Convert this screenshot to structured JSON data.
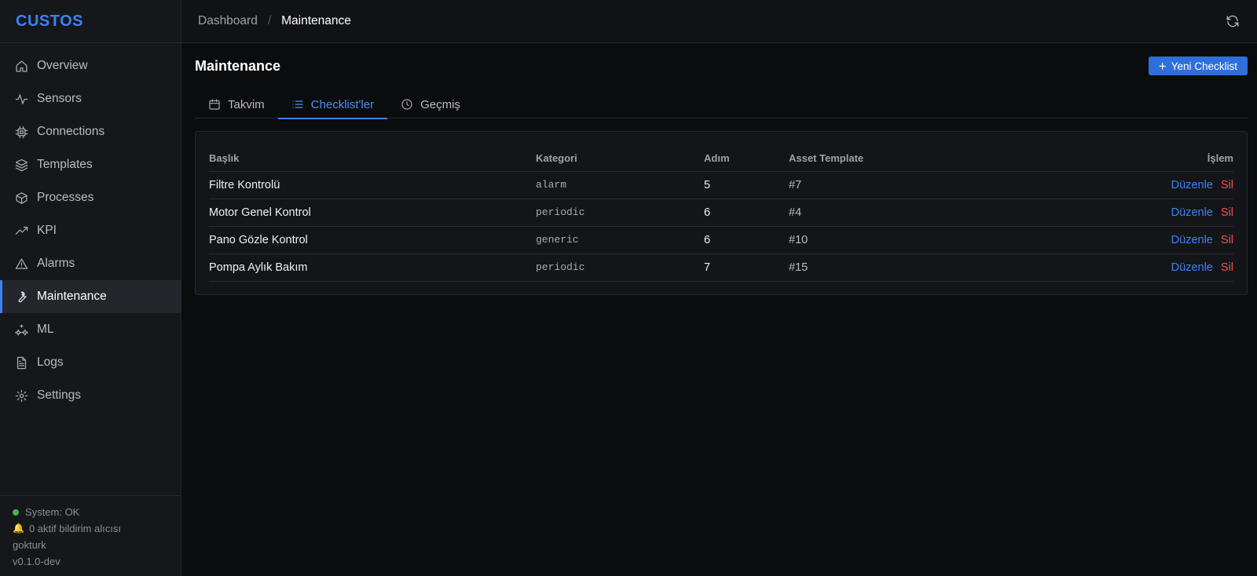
{
  "brand": "CUSTOS",
  "sidebar": {
    "items": [
      {
        "label": "Overview",
        "icon": "home-icon"
      },
      {
        "label": "Sensors",
        "icon": "activity-icon"
      },
      {
        "label": "Connections",
        "icon": "chip-icon"
      },
      {
        "label": "Templates",
        "icon": "layers-icon"
      },
      {
        "label": "Processes",
        "icon": "box-icon"
      },
      {
        "label": "KPI",
        "icon": "trending-up-icon"
      },
      {
        "label": "Alarms",
        "icon": "alert-triangle-icon"
      },
      {
        "label": "Maintenance",
        "icon": "wrench-icon",
        "active": true
      },
      {
        "label": "ML",
        "icon": "sparkles-icon"
      },
      {
        "label": "Logs",
        "icon": "file-text-icon"
      },
      {
        "label": "Settings",
        "icon": "gear-icon"
      }
    ],
    "footer": {
      "system_status": "System: OK",
      "notifications": "0 aktif bildirim alıcısı",
      "user": "gokturk",
      "version": "v0.1.0-dev"
    }
  },
  "breadcrumb": {
    "parent": "Dashboard",
    "separator": "/",
    "current": "Maintenance"
  },
  "page": {
    "title": "Maintenance",
    "new_button": "Yeni Checklist"
  },
  "tabs": [
    {
      "label": "Takvim",
      "icon": "calendar-icon"
    },
    {
      "label": "Checklist'ler",
      "icon": "list-icon",
      "active": true
    },
    {
      "label": "Geçmiş",
      "icon": "clock-icon"
    }
  ],
  "table": {
    "headers": {
      "title": "Başlık",
      "category": "Kategori",
      "steps": "Adım",
      "asset": "Asset Template",
      "actions": "İşlem"
    },
    "rows": [
      {
        "title": "Filtre Kontrolü",
        "category": "alarm",
        "steps": "5",
        "asset": "#7"
      },
      {
        "title": "Motor Genel Kontrol",
        "category": "periodic",
        "steps": "6",
        "asset": "#4"
      },
      {
        "title": "Pano Gözle Kontrol",
        "category": "generic",
        "steps": "6",
        "asset": "#10"
      },
      {
        "title": "Pompa Aylık Bakım",
        "category": "periodic",
        "steps": "7",
        "asset": "#15"
      }
    ],
    "edit_label": "Düzenle",
    "delete_label": "Sil"
  },
  "colors": {
    "accent": "#3b82f6",
    "danger": "#ef5350",
    "status_ok": "#4caf50"
  }
}
